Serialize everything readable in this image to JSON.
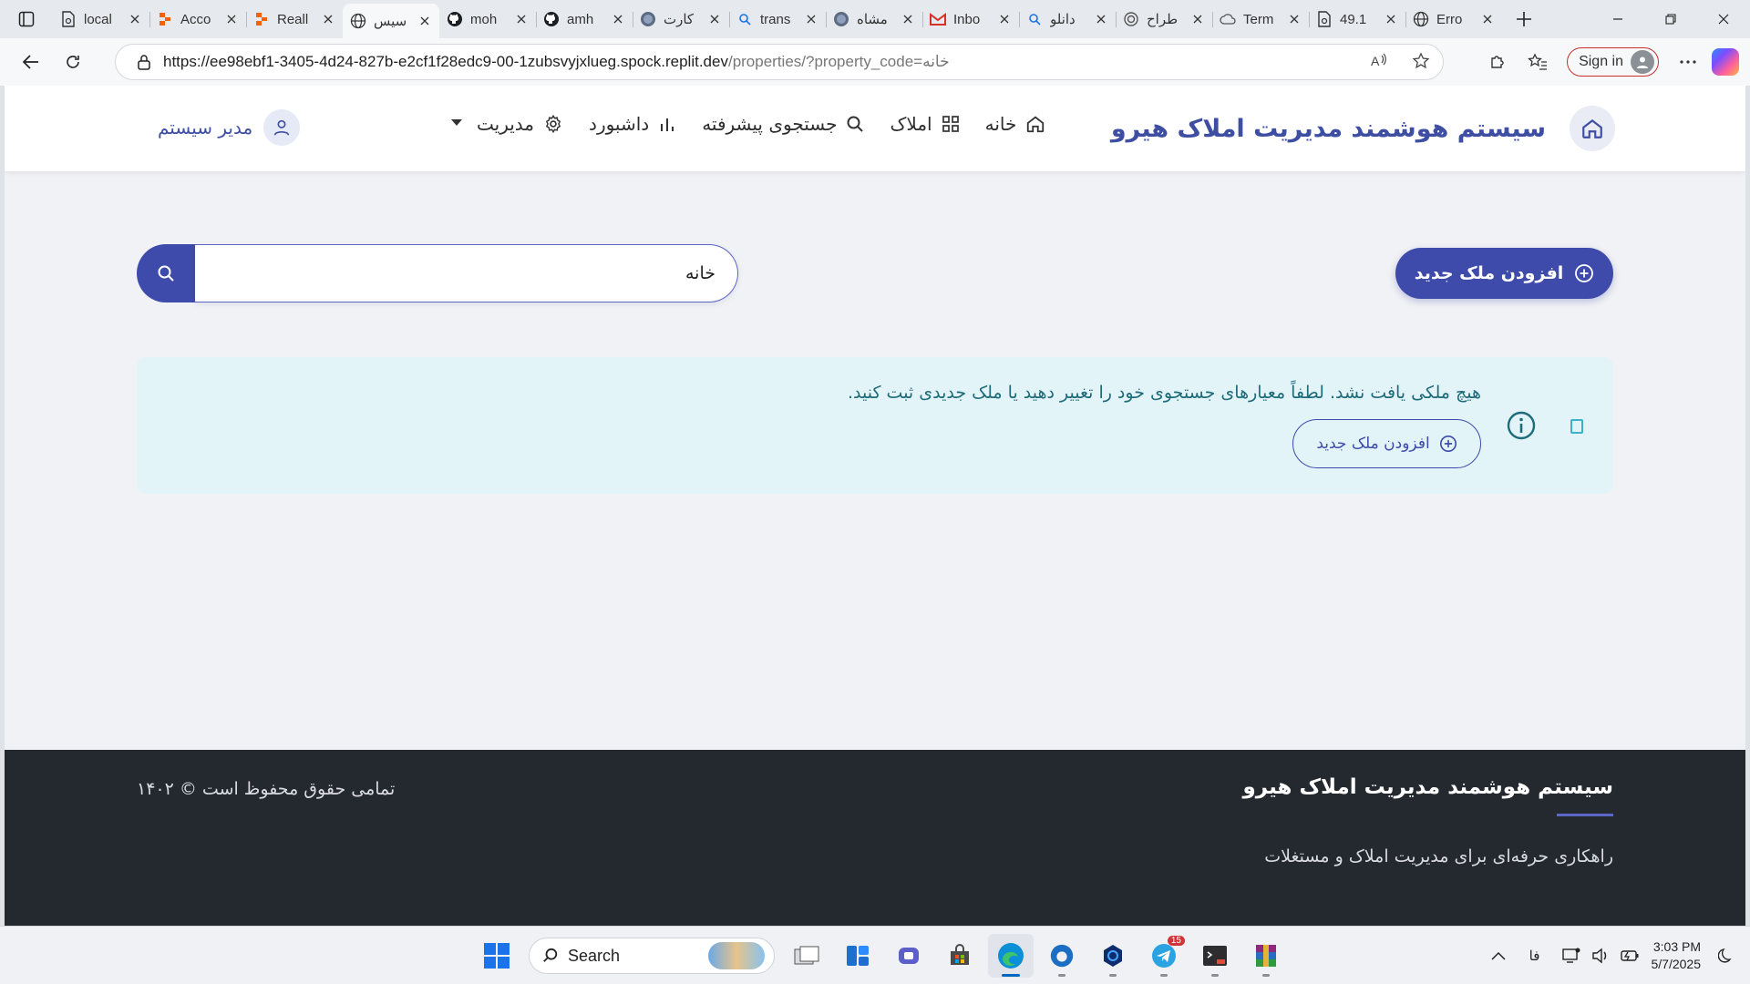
{
  "browser": {
    "tabs": [
      {
        "title": "local",
        "icon": "doc-icon"
      },
      {
        "title": "Acco",
        "icon": "replit-icon"
      },
      {
        "title": "Reall",
        "icon": "replit-icon"
      },
      {
        "title": "سیس",
        "icon": "globe-icon",
        "active": true
      },
      {
        "title": "moh",
        "icon": "github-icon"
      },
      {
        "title": "amh",
        "icon": "github-icon"
      },
      {
        "title": "کارت",
        "icon": "image-icon"
      },
      {
        "title": "trans",
        "icon": "search-icon"
      },
      {
        "title": "مشاه",
        "icon": "image-icon"
      },
      {
        "title": "Inbo",
        "icon": "gmail-icon"
      },
      {
        "title": "دانلو",
        "icon": "search-icon"
      },
      {
        "title": "طراح",
        "icon": "openai-icon"
      },
      {
        "title": "Term",
        "icon": "cloud-icon"
      },
      {
        "title": "49.1",
        "icon": "doc-icon"
      },
      {
        "title": "Erro",
        "icon": "globe-icon"
      }
    ],
    "url_main": "https://ee98ebf1-3405-4d24-827b-e2cf1f28edc9-00-1zubsvyjxlueg.spock.replit.dev",
    "url_rest": "/properties/?property_code=خانه",
    "signin_label": "Sign in"
  },
  "app": {
    "brand": "سیستم هوشمند مدیریت املاک هیرو",
    "menu": [
      {
        "label": "خانه",
        "icon": "home-icon"
      },
      {
        "label": "املاک",
        "icon": "grid-icon"
      },
      {
        "label": "جستجوی پیشرفته",
        "icon": "search-icon"
      },
      {
        "label": "داشبورد",
        "icon": "bar-chart-icon"
      },
      {
        "label": "مدیریت",
        "icon": "gear-icon"
      }
    ],
    "user_name": "مدیر سیستم",
    "add_button": "افزودن ملک جدید",
    "search": {
      "value": "خانه"
    },
    "alert": {
      "message": "هیچ ملکی یافت نشد. لطفاً معیارهای جستجوی خود را تغییر دهید یا ملک جدیدی ثبت کنید.",
      "button": "افزودن ملک جدید"
    },
    "footer": {
      "brand": "سیستم هوشمند مدیریت املاک هیرو",
      "tagline": "راهکاری حرفه‌ای برای مدیریت املاک و مستغلات",
      "copyright": "تمامی حقوق محفوظ است © ۱۴۰۲"
    },
    "colors": {
      "primary": "#3e4bab",
      "alert_bg": "#e2f4f8",
      "alert_text": "#1e6b79",
      "footer_bg": "#24282f"
    }
  },
  "taskbar": {
    "search_label": "Search",
    "telegram_badge": "15",
    "lang": "فا",
    "time": "3:03 PM",
    "date": "5/7/2025"
  }
}
